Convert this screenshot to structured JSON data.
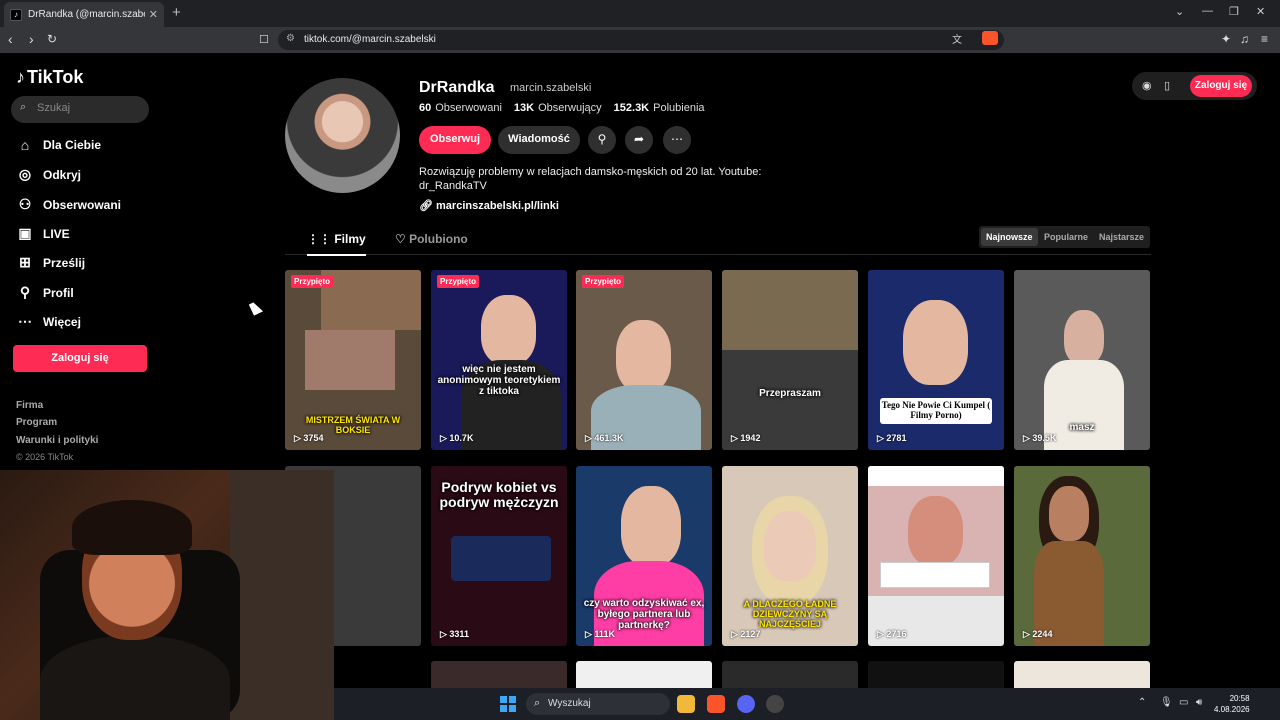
{
  "browser": {
    "tab_title": "DrRandka (@marcin.szabelski) |",
    "url": "tiktok.com/@marcin.szabelski",
    "new_tab": "+",
    "tab_close": "✕"
  },
  "sidebar": {
    "logo": "TikTok",
    "search_placeholder": "Szukaj",
    "items": [
      {
        "label": "Dla Ciebie",
        "icon": "home-icon"
      },
      {
        "label": "Odkryj",
        "icon": "compass-icon"
      },
      {
        "label": "Obserwowani",
        "icon": "following-icon"
      },
      {
        "label": "LIVE",
        "icon": "live-icon"
      },
      {
        "label": "Prześlij",
        "icon": "upload-icon"
      },
      {
        "label": "Profil",
        "icon": "profile-icon"
      },
      {
        "label": "Więcej",
        "icon": "more-icon"
      }
    ],
    "login": "Zaloguj się",
    "footer": [
      "Firma",
      "Program",
      "Warunki i polityki"
    ],
    "copyright": "© 2026 TikTok"
  },
  "profile": {
    "name": "DrRandka",
    "handle": "marcin.szabelski",
    "following_count": "60",
    "following_label": "Obserwowani",
    "followers_count": "13K",
    "followers_label": "Obserwujący",
    "likes_count": "152.3K",
    "likes_label": "Polubienia",
    "follow_button": "Obserwuj",
    "message_button": "Wiadomość",
    "bio_line1": "Rozwiązuję problemy w relacjach damsko-męskich od 20 lat. Youtube:",
    "bio_line2": "dr_RandkaTV",
    "link": "marcinszabelski.pl/linki"
  },
  "top_right": {
    "login": "Zaloguj się"
  },
  "tabs": {
    "videos": "Filmy",
    "liked": "Polubiono"
  },
  "sort": {
    "newest": "Najnowsze",
    "popular": "Popularne",
    "oldest": "Najstarsze"
  },
  "videos_row1": [
    {
      "pinned": "Przypięto",
      "views": "3754",
      "caption": "MISTRZEM ŚWIATA W BOKSIE",
      "bg": "#5a4a3a"
    },
    {
      "pinned": "Przypięto",
      "views": "10.7K",
      "caption": "więc nie jestem anonimowym teoretykiem z tiktoka",
      "bg": "#1a1a5a"
    },
    {
      "pinned": "Przypięto",
      "views": "461.3K",
      "caption": "",
      "bg": "#6a5a4a"
    },
    {
      "pinned": "",
      "views": "1942",
      "caption": "Przepraszam",
      "bg": "#7a6a50"
    },
    {
      "pinned": "",
      "views": "2781",
      "caption": "Tego Nie Powie Ci Kumpel ( Filmy Porno)",
      "bg": "#1a2a6a"
    },
    {
      "pinned": "",
      "views": "39.5K",
      "caption": "masz",
      "bg": "#5a5a5a"
    }
  ],
  "videos_row2": [
    {
      "views": "",
      "caption": "",
      "bg": "#3a3a3a"
    },
    {
      "views": "3311",
      "caption": "Podryw kobiet vs podryw mężczyzn",
      "bg": "#2a0a14"
    },
    {
      "views": "111K",
      "caption": "czy warto odzyskiwać ex, byłego partnera lub partnerkę?",
      "bg": "#1a3a6a"
    },
    {
      "views": "2127",
      "caption": "A DLACZEGO ŁADNE DZIEWCZYNY SĄ NAJCZĘŚCIEJ",
      "bg": "#d8c8b8"
    },
    {
      "views": "2716",
      "caption": "",
      "bg": "#e8e8e8"
    },
    {
      "views": "2244",
      "caption": "",
      "bg": "#5a6a3a"
    }
  ],
  "taskbar": {
    "search": "Wyszukaj",
    "time": "20:58",
    "date": "4.08.2026"
  }
}
